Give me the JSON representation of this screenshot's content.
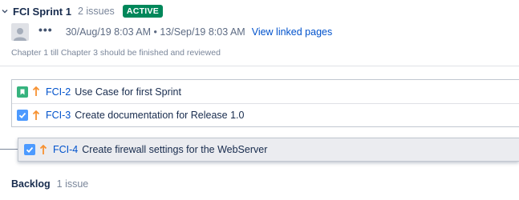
{
  "sprint": {
    "title": "FCI Sprint 1",
    "issue_count": "2 issues",
    "status": "ACTIVE",
    "more_label": "•••",
    "dates": "30/Aug/19 8:03 AM • 13/Sep/19 8:03 AM",
    "linked_pages_label": "View linked pages",
    "goal": "Chapter 1 till Chapter 3 should be finished and reviewed",
    "issues": [
      {
        "type": "story",
        "key": "FCI-2",
        "summary": "Use Case for first Sprint"
      },
      {
        "type": "task",
        "key": "FCI-3",
        "summary": "Create documentation for Release 1.0"
      }
    ]
  },
  "dragged_issue": {
    "type": "task",
    "key": "FCI-4",
    "summary": "Create firewall settings for the WebServer"
  },
  "backlog": {
    "title": "Backlog",
    "issue_count": "1 issue"
  },
  "colors": {
    "accent": "#0052cc",
    "active_badge": "#00875a",
    "story": "#36b37e",
    "task": "#4c9aff",
    "priority": "#f79232"
  },
  "icons": {
    "collapse": "chevron-down-icon",
    "story": "story-icon",
    "task": "task-icon",
    "priority": "priority-high-arrow-icon"
  }
}
